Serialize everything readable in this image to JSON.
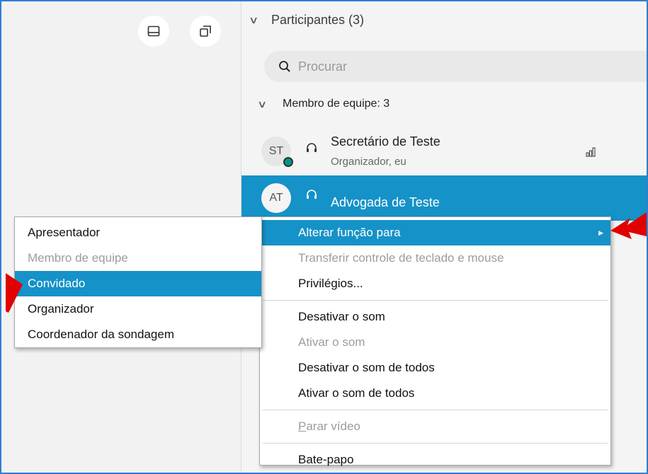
{
  "participants": {
    "header": "Participantes (3)",
    "search_placeholder": "Procurar",
    "group_label": "Membro de equipe: 3",
    "rows": [
      {
        "initials": "ST",
        "name": "Secretário de Teste",
        "role": "Organizador, eu"
      },
      {
        "initials": "AT",
        "name": "Advogada de Teste"
      }
    ]
  },
  "context_menu": {
    "change_role": "Alterar função para",
    "transfer_control": "Transferir controle de teclado e mouse",
    "privileges": "Privilégios...",
    "mute": "Desativar o som",
    "unmute": "Ativar o som",
    "mute_all": "Desativar o som de todos",
    "unmute_all": "Ativar o som de todos",
    "stop_video_first": "P",
    "stop_video_rest": "arar vídeo",
    "chat": "Bate-papo"
  },
  "role_submenu": {
    "presenter": "Apresentador",
    "team_member": "Membro de equipe",
    "guest": "Convidado",
    "organizer": "Organizador",
    "poll_coordinator": "Coordenador da sondagem"
  },
  "icons": {
    "panel": "panel-layout-icon",
    "popout": "pop-out-window-icon",
    "search": "magnifier-icon",
    "headset": "headset-icon",
    "signal": "signal-bars-icon",
    "annotation_arrow": "red-arrow"
  },
  "colors": {
    "accent": "#1592c8",
    "frame_border": "#2f7fd1",
    "annotation": "#e00000"
  }
}
